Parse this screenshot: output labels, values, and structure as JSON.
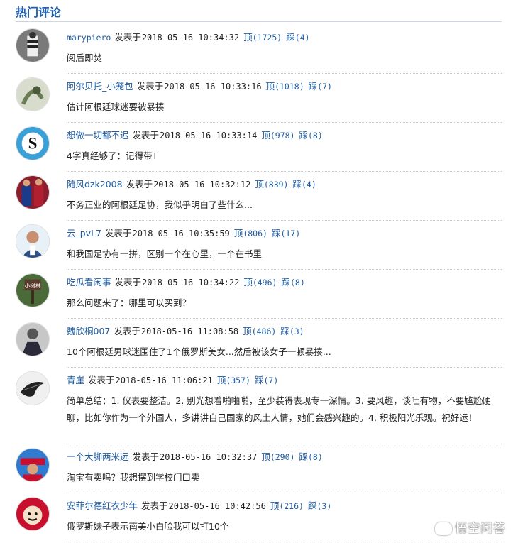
{
  "header": {
    "title": "热门评论"
  },
  "labels": {
    "posted": "发表于",
    "up": "顶",
    "down": "踩"
  },
  "comments": [
    {
      "user": "marypiero",
      "time": "2018-05-16 10:34:32",
      "up": "(1725)",
      "down": "(4)",
      "text": "阅后即焚"
    },
    {
      "user": "阿尔贝托_小笼包",
      "time": "2018-05-16 10:33:16",
      "up": "(1018)",
      "down": "(7)",
      "text": "估计阿根廷球迷要被暴揍"
    },
    {
      "user": "想做一切都不迟",
      "time": "2018-05-16 10:33:14",
      "up": "(978)",
      "down": "(8)",
      "text": "4字真经够了：记得带T"
    },
    {
      "user": "随风dzk2008",
      "time": "2018-05-16 10:32:12",
      "up": "(839)",
      "down": "(4)",
      "text": "不务正业的阿根廷足协，我似乎明白了些什么..."
    },
    {
      "user": "云_pvL7",
      "time": "2018-05-16 10:35:59",
      "up": "(806)",
      "down": "(17)",
      "text": "和我国足协有一拼，区别一个在心里，一个在书里"
    },
    {
      "user": "吃瓜看闲事",
      "time": "2018-05-16 10:34:22",
      "up": "(496)",
      "down": "(8)",
      "text": "那么问题来了：哪里可以买到？"
    },
    {
      "user": "魏欣桐007",
      "time": "2018-05-16 11:08:58",
      "up": "(486)",
      "down": "(3)",
      "text": "10个阿根廷男球迷围住了1个俄罗斯美女...然后被该女子一顿暴揍..."
    },
    {
      "user": "青崖",
      "time": "2018-05-16 11:06:21",
      "up": "(357)",
      "down": "(7)",
      "text": "简单总结：1. 仪表要整洁。2. 别光想着啪啪啪，至少装得表现专一深情。3. 要风趣，谈吐有物，不要尴尬硬聊，比如你作为一个外国人，多讲讲自己国家的风土人情，她们会感兴趣的。4. 积极阳光乐观。祝好运！"
    },
    {
      "user": "一个大脚两米远",
      "time": "2018-05-16 10:32:37",
      "up": "(290)",
      "down": "(8)",
      "text": "淘宝有卖吗？我想摆到学校门口卖"
    },
    {
      "user": "安菲尔德红衣少年",
      "time": "2018-05-16 10:42:56",
      "up": "(216)",
      "down": "(3)",
      "text": "俄罗斯妹子表示南美小白脸我可以打10个"
    }
  ],
  "watermark": "悟空问答",
  "colors": {
    "link": "#1e5ca3",
    "title": "#1f5fb4"
  }
}
